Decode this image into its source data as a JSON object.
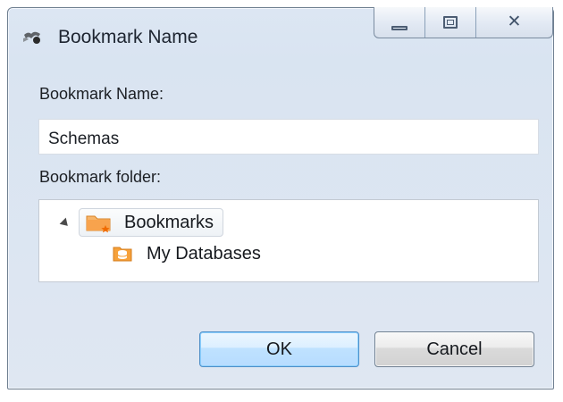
{
  "window": {
    "title": "Bookmark Name",
    "icon": "app-icon",
    "controls": {
      "minimize": "minimize-icon",
      "maximize": "maximize-icon",
      "close": "close-icon"
    }
  },
  "form": {
    "bookmark_name_label": "Bookmark Name:",
    "bookmark_name_value": "Schemas",
    "bookmark_folder_label": "Bookmark folder:"
  },
  "tree": {
    "root": {
      "label": "Bookmarks",
      "icon": "bookmarks-folder-icon",
      "expanded": true,
      "selected": true
    },
    "children": [
      {
        "label": "My Databases",
        "icon": "database-folder-icon"
      }
    ]
  },
  "buttons": {
    "ok": "OK",
    "cancel": "Cancel"
  },
  "colors": {
    "window_bg": "#dce6f3",
    "accent_blue": "#4d8ec7",
    "folder_orange": "#f7a14a",
    "database_orange": "#f2a03a"
  }
}
